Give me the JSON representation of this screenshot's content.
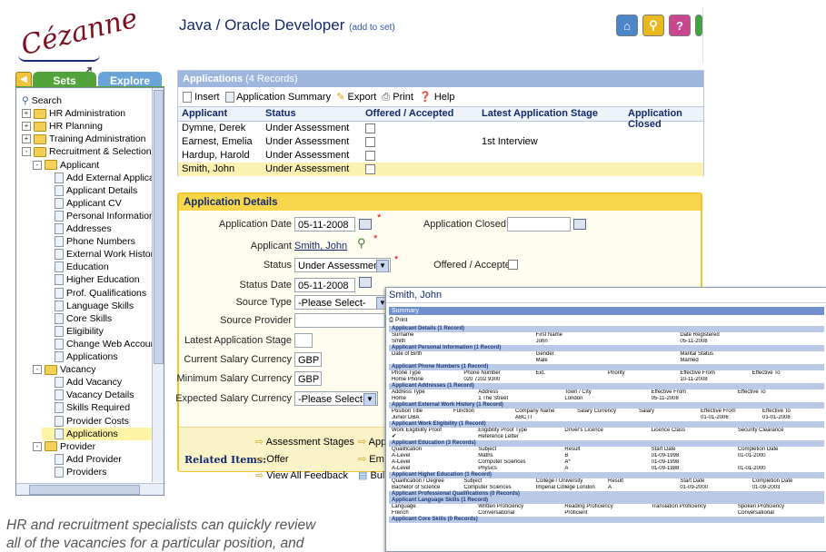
{
  "logo": "Cézanne",
  "header": {
    "title": "Java / Oracle Developer",
    "add_link": "(add to set)"
  },
  "left_tabs": {
    "sets": "Sets",
    "explore": "Explore"
  },
  "tree": [
    {
      "label": "Search",
      "level": 0,
      "icon": "search"
    },
    {
      "label": "HR Administration",
      "level": 0,
      "icon": "folder",
      "toggle": "+"
    },
    {
      "label": "HR Planning",
      "level": 0,
      "icon": "folder",
      "toggle": "+"
    },
    {
      "label": "Training Administration",
      "level": 0,
      "icon": "folder",
      "toggle": "+"
    },
    {
      "label": "Recruitment & Selection",
      "level": 0,
      "icon": "folder",
      "toggle": "-"
    },
    {
      "label": "Applicant",
      "level": 1,
      "icon": "folder",
      "toggle": "-"
    },
    {
      "label": "Add External Applicant",
      "level": 2,
      "icon": "doc"
    },
    {
      "label": "Applicant Details",
      "level": 2,
      "icon": "doc"
    },
    {
      "label": "Applicant CV",
      "level": 2,
      "icon": "doc"
    },
    {
      "label": "Personal Information",
      "level": 2,
      "icon": "doc"
    },
    {
      "label": "Addresses",
      "level": 2,
      "icon": "doc"
    },
    {
      "label": "Phone Numbers",
      "level": 2,
      "icon": "doc"
    },
    {
      "label": "External Work History",
      "level": 2,
      "icon": "doc"
    },
    {
      "label": "Education",
      "level": 2,
      "icon": "doc"
    },
    {
      "label": "Higher Education",
      "level": 2,
      "icon": "doc"
    },
    {
      "label": "Prof. Qualifications",
      "level": 2,
      "icon": "doc"
    },
    {
      "label": "Language Skills",
      "level": 2,
      "icon": "doc"
    },
    {
      "label": "Core Skills",
      "level": 2,
      "icon": "doc"
    },
    {
      "label": "Eligibility",
      "level": 2,
      "icon": "doc"
    },
    {
      "label": "Change Web Account F",
      "level": 2,
      "icon": "doc"
    },
    {
      "label": "Applications",
      "level": 2,
      "icon": "doc"
    },
    {
      "label": "Vacancy",
      "level": 1,
      "icon": "folder",
      "toggle": "-"
    },
    {
      "label": "Add Vacancy",
      "level": 2,
      "icon": "doc"
    },
    {
      "label": "Vacancy Details",
      "level": 2,
      "icon": "doc"
    },
    {
      "label": "Skills Required",
      "level": 2,
      "icon": "doc"
    },
    {
      "label": "Provider Costs",
      "level": 2,
      "icon": "doc"
    },
    {
      "label": "Applications",
      "level": 2,
      "icon": "doc",
      "selected": true
    },
    {
      "label": "Provider",
      "level": 1,
      "icon": "folder",
      "toggle": "-"
    },
    {
      "label": "Add Provider",
      "level": 2,
      "icon": "doc"
    },
    {
      "label": "Providers",
      "level": 2,
      "icon": "doc"
    }
  ],
  "applications": {
    "title": "Applications",
    "count": "(4 Records)",
    "toolbar": {
      "insert": "Insert",
      "summary": "Application Summary",
      "export": "Export",
      "print": "Print",
      "help": "Help"
    },
    "columns": [
      "Applicant",
      "Status",
      "Offered / Accepted",
      "Latest Application Stage",
      "Application Closed"
    ],
    "rows": [
      {
        "applicant": "Dymne, Derek",
        "status": "Under Assessment",
        "stage": ""
      },
      {
        "applicant": "Earnest, Emelia",
        "status": "Under Assessment",
        "stage": "1st Interview"
      },
      {
        "applicant": "Hardup, Harold",
        "status": "Under Assessment",
        "stage": ""
      },
      {
        "applicant": "Smith, John",
        "status": "Under Assessment",
        "stage": "",
        "selected": true
      }
    ]
  },
  "details": {
    "title": "Application Details",
    "application_date_label": "Application Date",
    "application_date": "05-11-2008",
    "application_closed_label": "Application Closed",
    "applicant_label": "Applicant",
    "applicant": "Smith, John",
    "status_label": "Status",
    "status": "Under Assessment",
    "offered_label": "Offered / Accepted",
    "status_date_label": "Status Date",
    "status_date": "05-11-2008",
    "source_type_label": "Source Type",
    "source_type": "-Please Select-",
    "source_provider_label": "Source Provider",
    "latest_stage_label": "Latest Application Stage",
    "current_currency_label": "Current Salary Currency",
    "current_currency": "GBP",
    "min_currency_label": "Minimum Salary Currency",
    "min_currency": "GBP",
    "expected_currency_label": "Expected Salary Currency",
    "expected_currency": "-Please Select-",
    "related_label": "Related Items:",
    "related": {
      "assessment_stages": "Assessment Stages",
      "app": "App",
      "offer": "Offer",
      "em": "Em",
      "view_all_feedback": "View All Feedback",
      "buli": "Buli"
    }
  },
  "summary": {
    "window_title": "Smith, John",
    "header": "Summary",
    "print": "Print",
    "sections": [
      {
        "title": "Applicant Details (1 Record)",
        "rows": [
          [
            "Surname",
            "First Name",
            "Date Registered"
          ],
          [
            "Smith",
            "John",
            "05-11-2008"
          ]
        ]
      },
      {
        "title": "Applicant Personal Information (1 Record)",
        "rows": [
          [
            "Date of Birth",
            "Gender",
            "Marital Status"
          ],
          [
            "",
            "Male",
            "Married"
          ]
        ]
      },
      {
        "title": "Applicant Phone Numbers (1 Record)",
        "rows": [
          [
            "Phone Type",
            "Phone Number",
            "Ext.",
            "Priority",
            "Effective From",
            "Effective To"
          ],
          [
            "Home Phone",
            "020 7202 9300",
            "",
            "",
            "10-11-2008",
            ""
          ]
        ]
      },
      {
        "title": "Applicant Addresses (1 Record)",
        "rows": [
          [
            "Address Type",
            "Address",
            "Town / City",
            "Effective From",
            "Effective To"
          ],
          [
            "Home",
            "1 The Street",
            "London",
            "05-11-2008",
            ""
          ]
        ]
      },
      {
        "title": "Applicant External Work History (1 Record)",
        "rows": [
          [
            "Position Title",
            "Function",
            "Company Name",
            "Salary Currency",
            "Salary",
            "Effective From",
            "Effective To"
          ],
          [
            "Junior DBA",
            "",
            "ABC IT",
            "",
            "",
            "01-01-2006",
            "01-01-2008"
          ]
        ]
      },
      {
        "title": "Applicant Work Eligibility (1 Record)",
        "rows": [
          [
            "Work Eligibility Proof",
            "Eligibility Proof Type",
            "Driver's Licence",
            "Licence Class",
            "Security Clearance"
          ],
          [
            "✔",
            "Reference Letter",
            "",
            "",
            ""
          ]
        ]
      },
      {
        "title": "Applicant Education (3 Records)",
        "rows": [
          [
            "Qualification",
            "Subject",
            "Result",
            "Start Date",
            "Completion Date"
          ],
          [
            "A-Level",
            "Maths",
            "B",
            "01-09-1998",
            "01-01-2000"
          ],
          [
            "A-Level",
            "Computer Sciences",
            "A*",
            "01-09-1998",
            ""
          ],
          [
            "A-Level",
            "Physics",
            "A",
            "01-09-1988",
            "01-01-2000"
          ]
        ]
      },
      {
        "title": "Applicant Higher Education (1 Record)",
        "rows": [
          [
            "Qualification / Degree",
            "Subject",
            "College / University",
            "Result",
            "Start Date",
            "Completion Date"
          ],
          [
            "Bachelor of Science",
            "Computer Sciences",
            "Imperial College London",
            "A",
            "01-09-2000",
            "01-09-2003"
          ]
        ]
      },
      {
        "title": "Applicant Professional Qualifications (0 Records)",
        "rows": []
      },
      {
        "title": "Applicant Language Skills (1 Record)",
        "rows": [
          [
            "Language",
            "Written Proficiency",
            "Reading Proficiency",
            "Translation Proficiency",
            "Spoken Proficiency"
          ],
          [
            "French",
            "Conversational",
            "Proficient",
            "",
            "Conversational"
          ]
        ]
      },
      {
        "title": "Applicant Core Skills (0 Records)",
        "rows": []
      }
    ]
  },
  "caption": [
    "HR and recruitment specialists can quickly review",
    "all of the vacancies for a particular position, and"
  ]
}
